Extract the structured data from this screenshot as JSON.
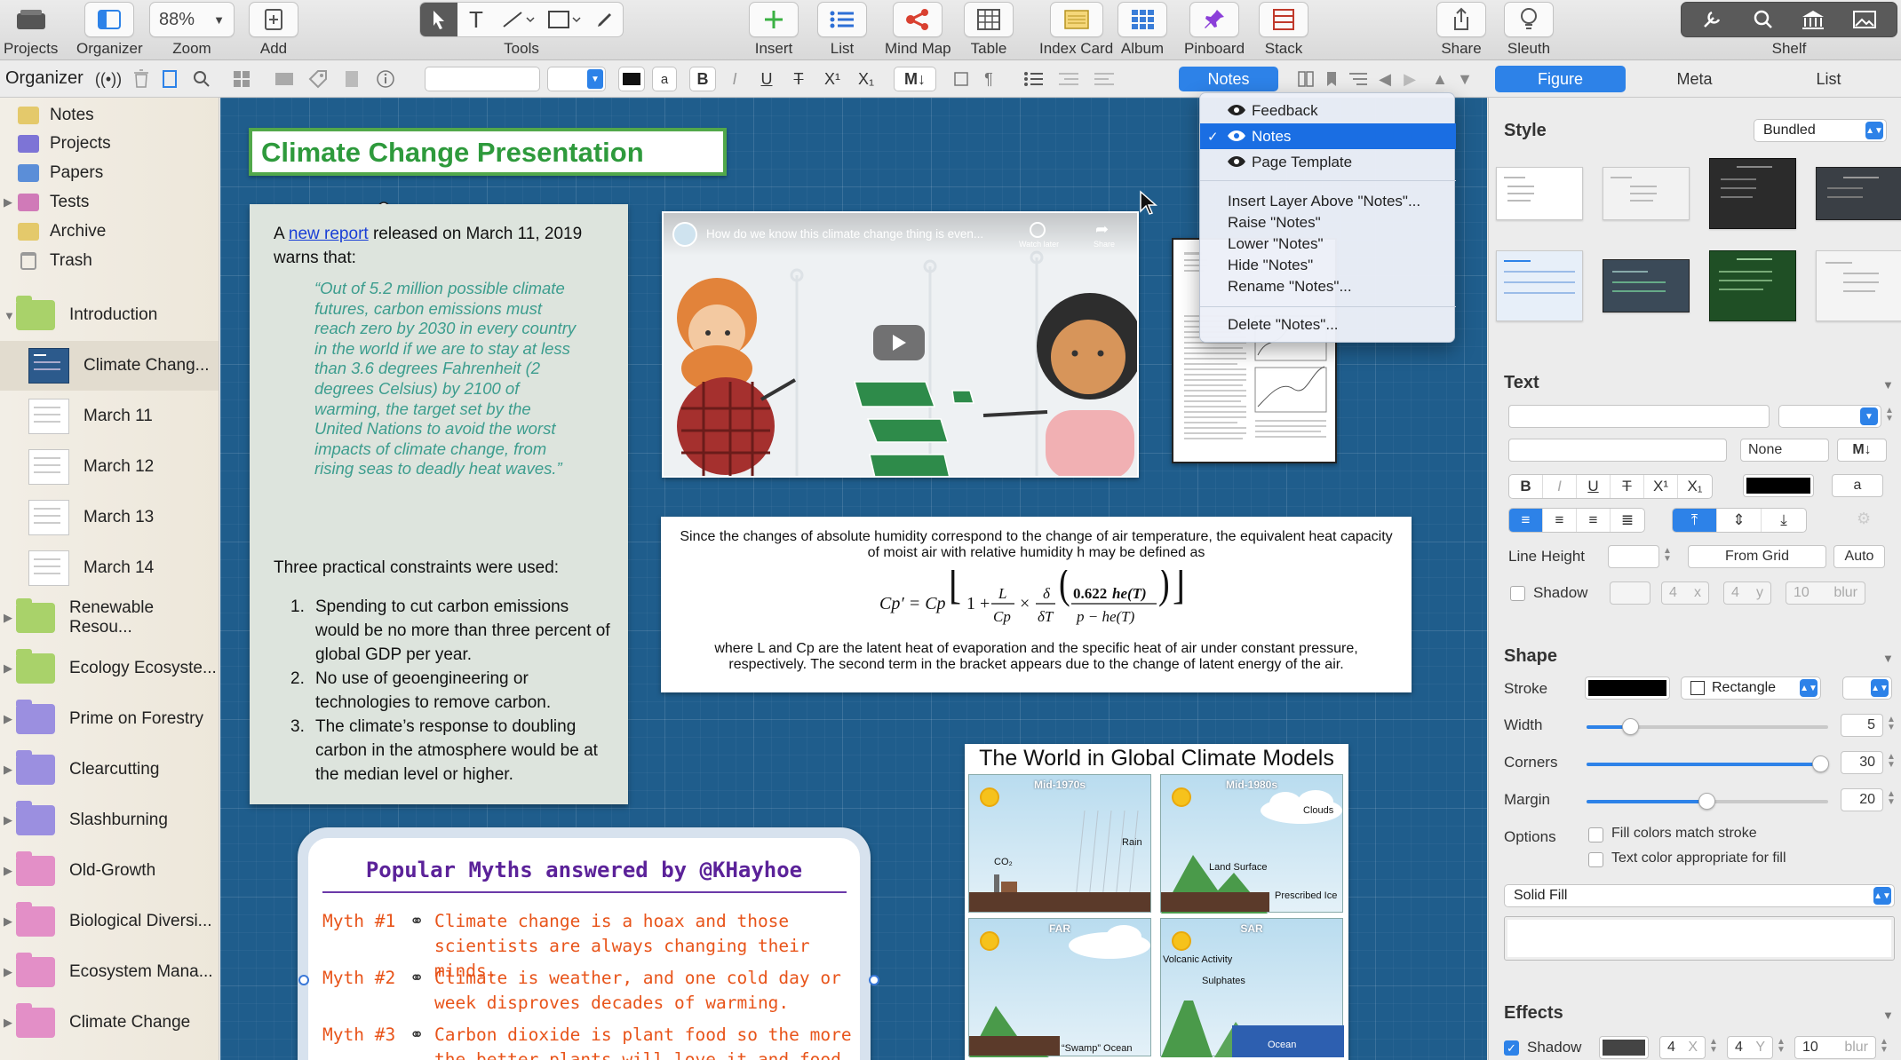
{
  "toolbar": {
    "items": {
      "projects": "Projects",
      "organizer": "Organizer",
      "zoom": "Zoom",
      "zoom_value": "88%",
      "add": "Add",
      "tools": "Tools",
      "insert": "Insert",
      "list": "List",
      "mindmap": "Mind Map",
      "table": "Table",
      "indexcard": "Index Card",
      "album": "Album",
      "pinboard": "Pinboard",
      "stack": "Stack",
      "share": "Share",
      "sleuth": "Sleuth",
      "shelf": "Shelf"
    }
  },
  "formatbar": {
    "organizer_label": "Organizer",
    "bold": "B",
    "italic": "I",
    "underline": "U",
    "strike": "T",
    "superscript": "X¹",
    "subscript": "X₁",
    "markdown": "M↓",
    "text_color_swatch": "a",
    "layer_button": "Notes"
  },
  "sidebar": {
    "top": [
      "Notes",
      "Projects",
      "Papers",
      "Tests",
      "Archive",
      "Trash"
    ],
    "intro": "Introduction",
    "docs": [
      "Climate Chang...",
      "March 11",
      "March 12",
      "March 13",
      "March 14"
    ],
    "folders": [
      "Renewable Resou...",
      "Ecology Ecosyste...",
      "Prime on Forestry",
      "Clearcutting",
      "Slashburning",
      "Old-Growth",
      "Biological Diversi...",
      "Ecosystem Mana...",
      "Climate Change"
    ]
  },
  "canvas": {
    "title": "Climate Change Presentation",
    "notes": {
      "intro_pre": "A ",
      "intro_link": "new report",
      "intro_post": " released on March 11, 2019",
      "intro_line2": "warns that:",
      "quote": "“Out of 5.2 million possible climate futures, carbon emissions must reach zero by 2030 in every country in the world if we are to stay at less than 3.6 degrees Fahrenheit (2 degrees Celsius) by 2100 of warming, the target set by the United Nations to avoid the worst impacts of climate change, from rising seas to deadly heat waves.”",
      "constraints_heading": "Three practical constraints were used:",
      "constraints": [
        "Spending to cut carbon emissions would be no more than three percent of global GDP per year.",
        "No use of geoengineering or technologies to remove carbon.",
        "The climate’s response to doubling carbon in the atmosphere would be at the median level or higher."
      ],
      "constraint_numbers": [
        "1.",
        "2.",
        "3."
      ]
    },
    "video": {
      "title": "How do we know this climate change thing is even...",
      "watch_later": "Watch later",
      "share": "Share"
    },
    "equation": {
      "line1": "Since the changes of absolute humidity correspond to the change of air temperature, the equivalent heat capacity of moist air with relative humidity h may be defined as",
      "line2": "where L and Cp are the latent heat of evaporation and the specific heat of air under constant pressure, respectively. The second term in the bracket appears due to the change of latent energy of the air."
    },
    "gcm": {
      "title": "The World in Global Climate Models",
      "panels": [
        "Mid-1970s",
        "Mid-1980s",
        "FAR",
        "SAR"
      ],
      "labels": {
        "rain": "Rain",
        "co2": "CO₂",
        "clouds": "Clouds",
        "land": "Land Surface",
        "ice": "Prescribed Ice",
        "swamp": "“Swamp” Ocean",
        "volcanic": "Volcanic Activity",
        "sulphates": "Sulphates",
        "ocean": "Ocean"
      }
    },
    "myths": {
      "title": "Popular Myths answered by @KHayhoe",
      "items": [
        {
          "label": "Myth #1",
          "text": "Climate change is a hoax and those scientists are always changing their minds."
        },
        {
          "label": "Myth #2",
          "text": "Climate is weather, and one cold day or week disproves decades of warming."
        },
        {
          "label": "Myth #3",
          "text": "Carbon dioxide is plant food so the more the better plants will love it and food will"
        }
      ]
    }
  },
  "layer_menu": {
    "layers": [
      "Feedback",
      "Notes",
      "Page Template"
    ],
    "actions": [
      "Insert Layer Above \"Notes\"...",
      "Raise \"Notes\"",
      "Lower \"Notes\"",
      "Hide \"Notes\"",
      "Rename \"Notes\"..."
    ],
    "delete": "Delete \"Notes\"...",
    "checkmark": "✓"
  },
  "inspector": {
    "tabs": [
      "Figure",
      "Meta",
      "List"
    ],
    "style": {
      "label": "Style",
      "value": "Bundled"
    },
    "text": {
      "label": "Text",
      "none": "None",
      "markdown": "M↓",
      "swatch": "a",
      "line_height_label": "Line Height",
      "from_grid": "From Grid",
      "auto": "Auto",
      "shadow_label": "Shadow",
      "shadow_x": "4",
      "shadow_y": "4",
      "shadow_blur": "10",
      "x_unit": "x",
      "y_unit": "y",
      "blur_unit": "blur"
    },
    "shape": {
      "label": "Shape",
      "stroke_label": "Stroke",
      "shape_type": "Rectangle",
      "width_label": "Width",
      "width_value": "5",
      "corners_label": "Corners",
      "corners_value": "30",
      "margin_label": "Margin",
      "margin_value": "20",
      "options_label": "Options",
      "opt1": "Fill colors match stroke",
      "opt2": "Text color appropriate for fill",
      "fill": "Solid Fill"
    },
    "effects": {
      "label": "Effects",
      "shadow_label": "Shadow",
      "x": "4",
      "y": "4",
      "blur": "10",
      "x_unit": "X",
      "y_unit": "Y",
      "blur_unit": "blur"
    }
  },
  "colors": {
    "accent": "#2d82e8",
    "canvas": "#1f5d8c",
    "title_green": "#2e9a3c",
    "quote_teal": "#3c9d8e",
    "myth_orange": "#e8541a",
    "myth_purple": "#5b2299"
  }
}
